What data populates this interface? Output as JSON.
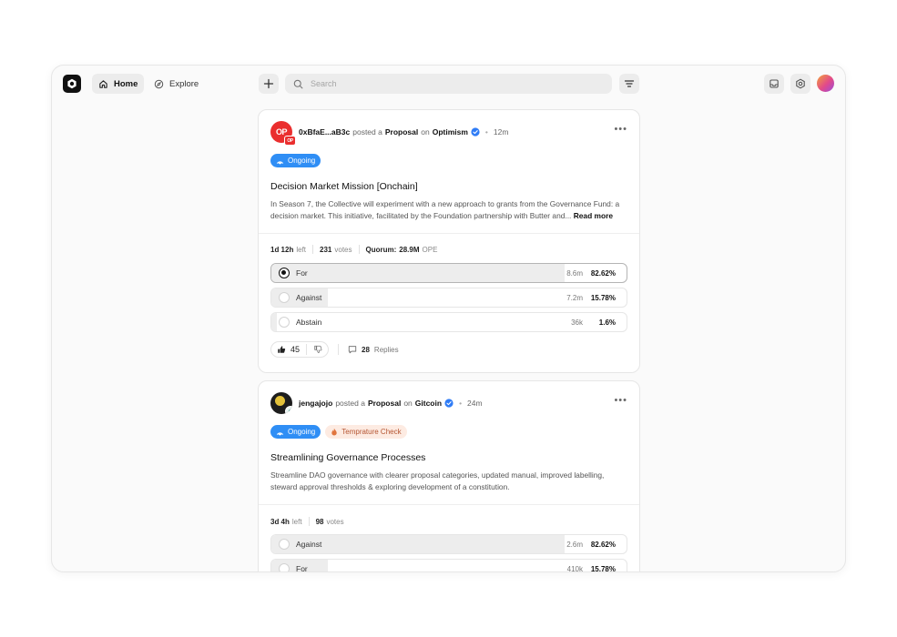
{
  "nav": {
    "home_label": "Home",
    "explore_label": "Explore",
    "search_placeholder": "Search"
  },
  "posts": [
    {
      "author": "0xBfaE...aB3c",
      "posted_text": "posted a",
      "type": "Proposal",
      "on_text": "on",
      "org": "Optimism",
      "org_badge": "OP",
      "avatar_initials": "OP",
      "time": "12m",
      "badges": [
        "Ongoing"
      ],
      "title": "Decision Market Mission [Onchain]",
      "description": "In Season 7, the Collective will experiment with a new approach to grants from the Governance Fund: a decision market. This initiative, facilitated by the Foundation partnership with Butter and...",
      "read_more": "Read more",
      "time_left": "1d 12h",
      "time_left_suffix": "left",
      "votes": "231",
      "votes_suffix": "votes",
      "quorum_label": "Quorum:",
      "quorum_value": "28.9M",
      "quorum_unit": "OPE",
      "options": [
        {
          "label": "For",
          "amount": "8.6m",
          "pct": "82.62%",
          "fill": 0.8262,
          "selected": true
        },
        {
          "label": "Against",
          "amount": "7.2m",
          "pct": "15.78%",
          "fill": 0.1578,
          "selected": false
        },
        {
          "label": "Abstain",
          "amount": "36k",
          "pct": "1.6%",
          "fill": 0.016,
          "selected": false
        }
      ],
      "likes": "45",
      "replies_count": "28",
      "replies_label": "Replies"
    },
    {
      "author": "jengajojo",
      "posted_text": "posted a",
      "type": "Proposal",
      "on_text": "on",
      "org": "Gitcoin",
      "time": "24m",
      "badges": [
        "Ongoing",
        "Temprature Check"
      ],
      "title": "Streamlining Governance Processes",
      "description": "Streamline DAO governance with clearer proposal categories, updated manual, improved labelling, steward approval thresholds & exploring development of a constitution.",
      "time_left": "3d 4h",
      "time_left_suffix": "left",
      "votes": "98",
      "votes_suffix": "votes",
      "options": [
        {
          "label": "Against",
          "amount": "2.6m",
          "pct": "82.62%",
          "fill": 0.8262,
          "selected": false
        },
        {
          "label": "For",
          "amount": "410k",
          "pct": "15.78%",
          "fill": 0.1578,
          "selected": false
        }
      ]
    }
  ],
  "colors": {
    "ongoing": "#2f8ef5",
    "temperature": "#fdebe2",
    "optimism": "#ea2e2e",
    "verified": "#2f7cf6"
  },
  "icons": [
    "logo-icon",
    "home-icon",
    "compass-icon",
    "plus-icon",
    "search-icon",
    "filter-icon",
    "inbox-icon",
    "settings-icon",
    "verified-icon",
    "more-icon",
    "ongoing-icon",
    "flame-icon",
    "thumbs-up-icon",
    "thumbs-down-icon",
    "comment-icon"
  ]
}
